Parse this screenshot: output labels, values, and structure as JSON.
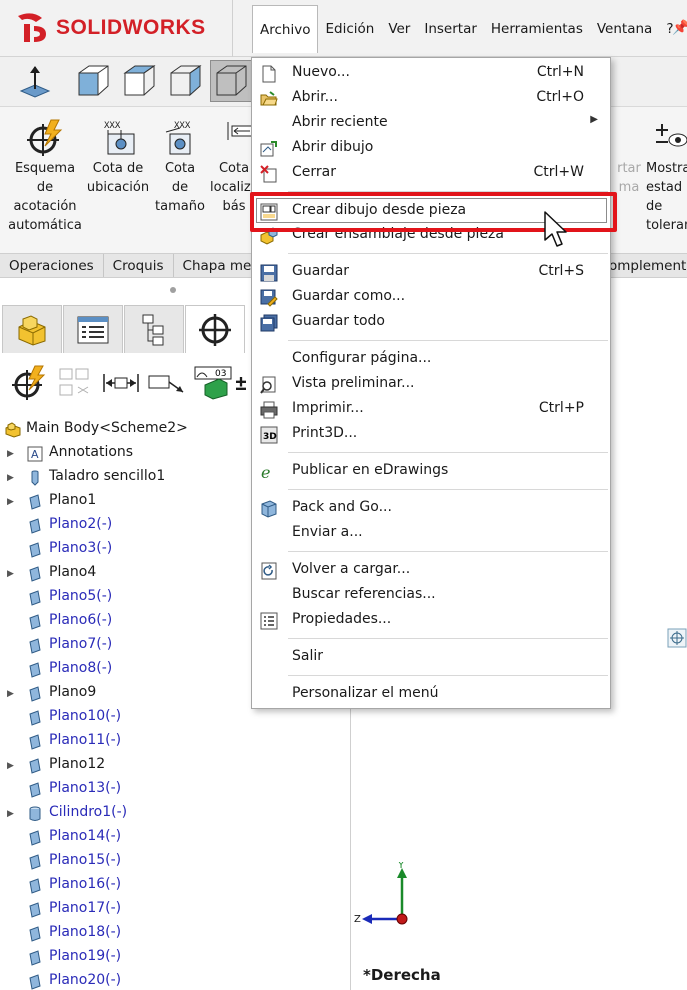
{
  "app": {
    "logo_text": "SOLIDWORKS",
    "brand_color": "#d32027"
  },
  "menubar": {
    "items": [
      "Archivo",
      "Edición",
      "Ver",
      "Insertar",
      "Herramientas",
      "Ventana",
      "?"
    ],
    "active": "Archivo"
  },
  "ribbon": {
    "buttons": [
      {
        "label": "Esquema\nde\nacotación\nautomática",
        "icon": "autodimension-icon"
      },
      {
        "label": "Cota de\nubicación",
        "icon": "location-dimension-icon"
      },
      {
        "label": "Cota\nde\ntamaño",
        "icon": "size-dimension-icon"
      },
      {
        "label": "Cota\nlocaliza\nbás",
        "icon": "basic-location-icon"
      },
      {
        "label": "rtar\nma",
        "icon": "faded-icon"
      },
      {
        "label": "Mostra\nestad\nde\ntoleran",
        "icon": "tolerance-status-icon"
      }
    ]
  },
  "cm_tabs": [
    "Operaciones",
    "Croquis",
    "Chapa met",
    "omplemento"
  ],
  "feature_tree": {
    "root": "Main Body<Scheme2>",
    "items": [
      {
        "label": "Annotations",
        "type": "annotations",
        "expandable": true,
        "blue": false
      },
      {
        "label": "Taladro sencillo1",
        "type": "hole",
        "expandable": true,
        "blue": false
      },
      {
        "label": "Plano1",
        "type": "plane",
        "expandable": true,
        "blue": false
      },
      {
        "label": "Plano2(-)",
        "type": "plane",
        "expandable": false,
        "blue": true
      },
      {
        "label": "Plano3(-)",
        "type": "plane",
        "expandable": false,
        "blue": true
      },
      {
        "label": "Plano4",
        "type": "plane",
        "expandable": true,
        "blue": false
      },
      {
        "label": "Plano5(-)",
        "type": "plane",
        "expandable": false,
        "blue": true
      },
      {
        "label": "Plano6(-)",
        "type": "plane",
        "expandable": false,
        "blue": true
      },
      {
        "label": "Plano7(-)",
        "type": "plane",
        "expandable": false,
        "blue": true
      },
      {
        "label": "Plano8(-)",
        "type": "plane",
        "expandable": false,
        "blue": true
      },
      {
        "label": "Plano9",
        "type": "plane",
        "expandable": true,
        "blue": false
      },
      {
        "label": "Plano10(-)",
        "type": "plane",
        "expandable": false,
        "blue": true
      },
      {
        "label": "Plano11(-)",
        "type": "plane",
        "expandable": false,
        "blue": true
      },
      {
        "label": "Plano12",
        "type": "plane",
        "expandable": true,
        "blue": false
      },
      {
        "label": "Plano13(-)",
        "type": "plane",
        "expandable": false,
        "blue": true
      },
      {
        "label": "Cilindro1(-)",
        "type": "cylinder",
        "expandable": true,
        "blue": true
      },
      {
        "label": "Plano14(-)",
        "type": "plane",
        "expandable": false,
        "blue": true
      },
      {
        "label": "Plano15(-)",
        "type": "plane",
        "expandable": false,
        "blue": true
      },
      {
        "label": "Plano16(-)",
        "type": "plane",
        "expandable": false,
        "blue": true
      },
      {
        "label": "Plano17(-)",
        "type": "plane",
        "expandable": false,
        "blue": true
      },
      {
        "label": "Plano18(-)",
        "type": "plane",
        "expandable": false,
        "blue": true
      },
      {
        "label": "Plano19(-)",
        "type": "plane",
        "expandable": false,
        "blue": true
      },
      {
        "label": "Plano20(-)",
        "type": "plane",
        "expandable": false,
        "blue": true
      }
    ]
  },
  "file_menu": {
    "groups": [
      [
        {
          "label": "Nuevo...",
          "shortcut": "Ctrl+N",
          "icon": "new-document-icon"
        },
        {
          "label": "Abrir...",
          "shortcut": "Ctrl+O",
          "icon": "open-folder-icon"
        },
        {
          "label": "Abrir reciente",
          "shortcut": "",
          "icon": "",
          "submenu": true
        },
        {
          "label": "Abrir dibujo",
          "shortcut": "",
          "icon": "open-drawing-icon"
        },
        {
          "label": "Cerrar",
          "shortcut": "Ctrl+W",
          "icon": "close-document-icon"
        }
      ],
      [
        {
          "label": "Crear dibujo desde pieza",
          "shortcut": "",
          "icon": "make-drawing-icon",
          "highlighted": true
        },
        {
          "label": "Crear ensamblaje desde pieza",
          "shortcut": "",
          "icon": "make-assembly-icon"
        }
      ],
      [
        {
          "label": "Guardar",
          "shortcut": "Ctrl+S",
          "icon": "save-icon"
        },
        {
          "label": "Guardar como...",
          "shortcut": "",
          "icon": "save-as-icon"
        },
        {
          "label": "Guardar todo",
          "shortcut": "",
          "icon": "save-all-icon"
        }
      ],
      [
        {
          "label": "Configurar página...",
          "shortcut": "",
          "icon": ""
        },
        {
          "label": "Vista preliminar...",
          "shortcut": "",
          "icon": "print-preview-icon"
        },
        {
          "label": "Imprimir...",
          "shortcut": "Ctrl+P",
          "icon": "print-icon"
        },
        {
          "label": "Print3D...",
          "shortcut": "",
          "icon": "print3d-icon"
        }
      ],
      [
        {
          "label": "Publicar en eDrawings",
          "shortcut": "",
          "icon": "edrawings-icon"
        }
      ],
      [
        {
          "label": "Pack and Go...",
          "shortcut": "",
          "icon": "pack-and-go-icon"
        },
        {
          "label": "Enviar a...",
          "shortcut": "",
          "icon": ""
        }
      ],
      [
        {
          "label": "Volver a cargar...",
          "shortcut": "",
          "icon": "reload-icon"
        },
        {
          "label": "Buscar referencias...",
          "shortcut": "",
          "icon": ""
        },
        {
          "label": "Propiedades...",
          "shortcut": "",
          "icon": "properties-icon"
        }
      ],
      [
        {
          "label": "Salir",
          "shortcut": "",
          "icon": ""
        }
      ],
      [
        {
          "label": "Personalizar el menú",
          "shortcut": "",
          "icon": ""
        }
      ]
    ]
  },
  "graphics": {
    "view_name": "*Derecha",
    "axis_y": "Y",
    "axis_z": "Z"
  },
  "colors": {
    "highlight_box": "#e2141a",
    "blue_item": "#2a2bb8"
  }
}
